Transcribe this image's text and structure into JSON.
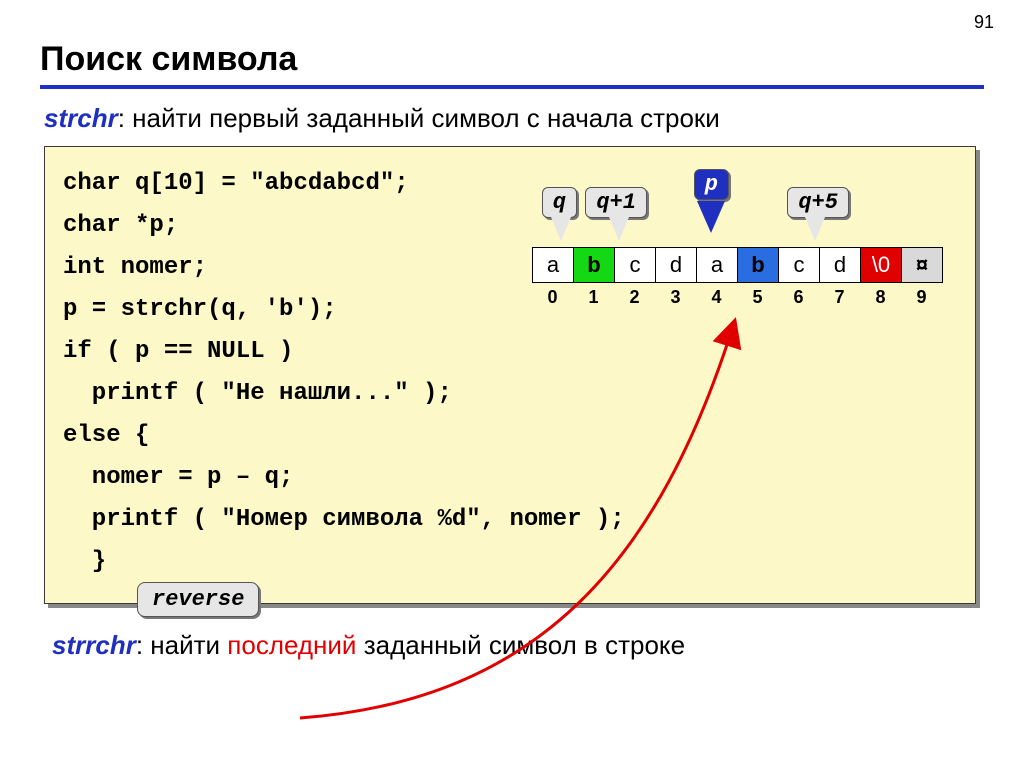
{
  "pageNumber": "91",
  "title": "Поиск символа",
  "intro": {
    "fn": "strchr",
    "rest": ": найти первый заданный символ c начала строки"
  },
  "code": "char q[10] = \"abcdabcd\";\nchar *p;\nint nomer;\np = strchr(q, 'b');\nif ( p == NULL )\n  printf ( \"Не нашли...\" );\nelse {\n  nomer = p – q;\n  printf ( \"Номер символа %d\", nomer );\n  }",
  "array": {
    "cells": [
      {
        "v": "a",
        "cls": ""
      },
      {
        "v": "b",
        "cls": "green"
      },
      {
        "v": "c",
        "cls": ""
      },
      {
        "v": "d",
        "cls": ""
      },
      {
        "v": "a",
        "cls": ""
      },
      {
        "v": "b",
        "cls": "blue"
      },
      {
        "v": "c",
        "cls": ""
      },
      {
        "v": "d",
        "cls": ""
      },
      {
        "v": "\\0",
        "cls": "red"
      },
      {
        "v": "¤",
        "cls": "gray"
      }
    ],
    "indices": [
      "0",
      "1",
      "2",
      "3",
      "4",
      "5",
      "6",
      "7",
      "8",
      "9"
    ]
  },
  "callouts": {
    "q": "q",
    "q1": "q+1",
    "p": "p",
    "q5": "q+5",
    "reverse": "reverse"
  },
  "footer": {
    "fn": "strrchr",
    "part1": ": найти ",
    "emph": "последний",
    "part2": " заданный символ в строке"
  }
}
